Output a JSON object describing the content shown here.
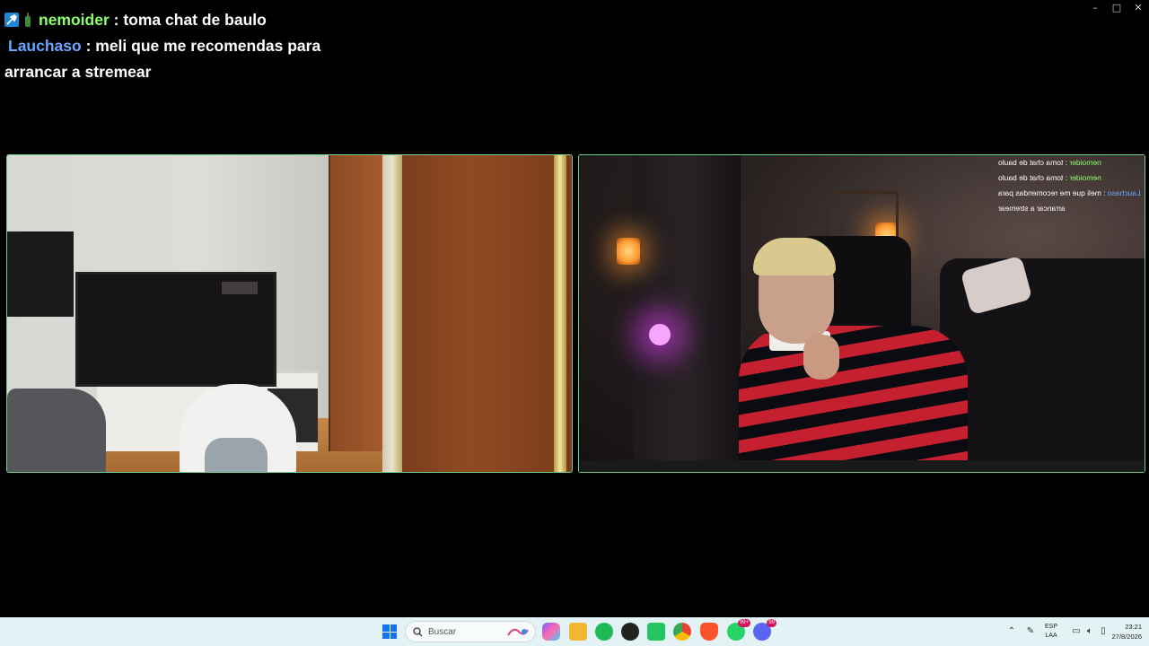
{
  "window": {
    "controls": {
      "minimize": "–",
      "maximize": "□",
      "close": "✕"
    }
  },
  "chat": {
    "messages": [
      {
        "user": "nemoider",
        "separator": " : ",
        "text": "toma chat de baulo",
        "user_color": "#8cff6c",
        "badges": [
          "moderator-icon",
          "bottle-icon"
        ]
      },
      {
        "user": "Lauchaso",
        "separator": " : ",
        "text_line1": "meli que me recomendas para",
        "text_line2": "arrancar a stremear",
        "user_color": "#6aa6ff"
      }
    ]
  },
  "mirrored_chat": {
    "lines": [
      {
        "user": "nemoider",
        "text": " : toma chat de baulo"
      },
      {
        "user": "nemoider",
        "text": " : toma chat de baulo"
      },
      {
        "user": "Lauchaso",
        "text": " : meli que me recomendas para"
      },
      {
        "user": "",
        "text": "arrancar a stremear"
      }
    ]
  },
  "panels": {
    "left": {
      "name": "camera-feed-left",
      "border_color": "#6fd08a"
    },
    "right": {
      "name": "camera-feed-right",
      "border_color": "#6fd08a"
    }
  },
  "taskbar": {
    "search_placeholder": "Buscar",
    "apps": [
      {
        "name": "copilot-icon",
        "color": "#7a5cff"
      },
      {
        "name": "file-explorer-icon",
        "color": "#f2b632"
      },
      {
        "name": "spotify-icon",
        "color": "#1db954"
      },
      {
        "name": "app-dark-icon",
        "color": "#222222"
      },
      {
        "name": "green-app-icon",
        "color": "#22c55e"
      },
      {
        "name": "chrome-icon",
        "color": "#e84335"
      },
      {
        "name": "brave-icon",
        "color": "#fb542b"
      },
      {
        "name": "whatsapp-icon",
        "color": "#25d366",
        "badge": "99+"
      },
      {
        "name": "discord-icon",
        "color": "#5865f2",
        "badge": "99"
      }
    ],
    "language_line1": "ESP",
    "language_line2": "LAA",
    "time": "23:21",
    "date": "27/8/2026"
  }
}
